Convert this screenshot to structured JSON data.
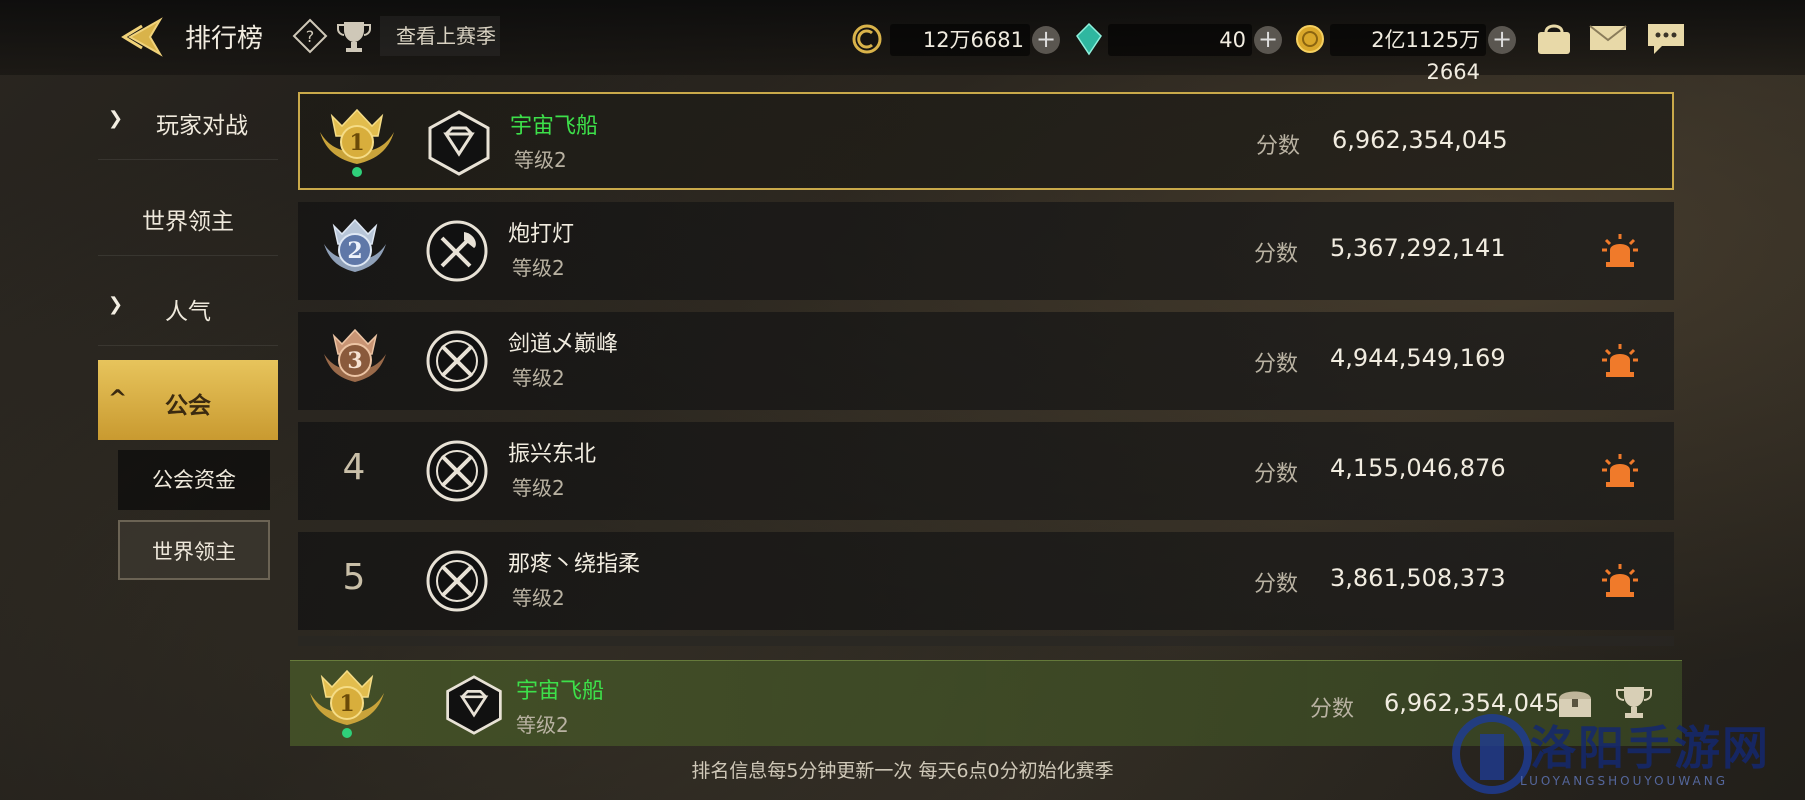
{
  "header": {
    "title": "排行榜",
    "last_season": "查看上赛季",
    "currencies": [
      {
        "name": "coin-c",
        "value": "12万6681"
      },
      {
        "name": "crystal",
        "value": "40"
      },
      {
        "name": "gold",
        "value": "2亿1125万2664"
      }
    ]
  },
  "sidebar": {
    "items": [
      {
        "label": "玩家对战",
        "expanded": false
      },
      {
        "label": "世界领主"
      },
      {
        "label": "人气",
        "expanded": false
      },
      {
        "label": "公会",
        "expanded": true
      }
    ],
    "subitems": [
      {
        "label": "公会资金"
      },
      {
        "label": "世界领主",
        "selected": true
      }
    ]
  },
  "ranking": {
    "score_label": "分数",
    "rows": [
      {
        "rank": "1",
        "name": "宇宙飞船",
        "level": "等级2",
        "score": "6,962,354,045",
        "highlight": true
      },
      {
        "rank": "2",
        "name": "炮打灯",
        "level": "等级2",
        "score": "5,367,292,141"
      },
      {
        "rank": "3",
        "name": "剑道乄巅峰",
        "level": "等级2",
        "score": "4,944,549,169"
      },
      {
        "rank": "4",
        "name": "振兴东北",
        "level": "等级2",
        "score": "4,155,046,876"
      },
      {
        "rank": "5",
        "name": "那疼丶绕指柔",
        "level": "等级2",
        "score": "3,861,508,373"
      }
    ]
  },
  "my_guild": {
    "rank": "1",
    "name": "宇宙飞船",
    "level": "等级2",
    "score_label": "分数",
    "score": "6,962,354,045"
  },
  "footer": {
    "note": "排名信息每5分钟更新一次 每天6点0分初始化赛季"
  },
  "watermark": {
    "text": "洛阳手游网",
    "sub": "LUOYANGSHOUYOUWANG"
  },
  "colors": {
    "accent_gold": "#e7c45c",
    "guild_green": "#3de04a",
    "alarm_orange": "#f07a2a"
  }
}
